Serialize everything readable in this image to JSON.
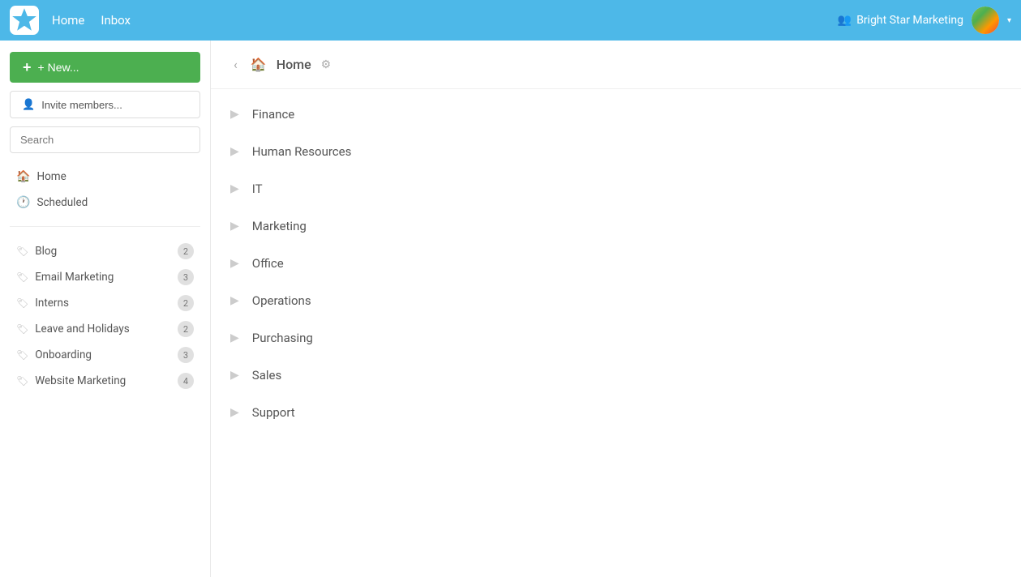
{
  "topnav": {
    "links": [
      {
        "label": "Home",
        "name": "home-nav-link"
      },
      {
        "label": "Inbox",
        "name": "inbox-nav-link"
      }
    ],
    "org_name": "Bright Star Marketing",
    "org_icon": "👥"
  },
  "sidebar": {
    "new_button_label": "+ New...",
    "invite_button_label": "Invite members...",
    "search_placeholder": "Search",
    "nav_items": [
      {
        "label": "Home",
        "icon": "🏠",
        "name": "sidebar-home"
      },
      {
        "label": "Scheduled",
        "icon": "🕐",
        "name": "sidebar-scheduled"
      }
    ],
    "tags": [
      {
        "label": "Blog",
        "badge": "2",
        "name": "tag-blog"
      },
      {
        "label": "Email Marketing",
        "badge": "3",
        "name": "tag-email-marketing"
      },
      {
        "label": "Interns",
        "badge": "2",
        "name": "tag-interns"
      },
      {
        "label": "Leave and Holidays",
        "badge": "2",
        "name": "tag-leave-holidays"
      },
      {
        "label": "Onboarding",
        "badge": "3",
        "name": "tag-onboarding"
      },
      {
        "label": "Website Marketing",
        "badge": "4",
        "name": "tag-website-marketing"
      }
    ]
  },
  "content": {
    "breadcrumb": "Home",
    "items": [
      {
        "label": "Finance",
        "name": "item-finance"
      },
      {
        "label": "Human Resources",
        "name": "item-hr"
      },
      {
        "label": "IT",
        "name": "item-it"
      },
      {
        "label": "Marketing",
        "name": "item-marketing"
      },
      {
        "label": "Office",
        "name": "item-office"
      },
      {
        "label": "Operations",
        "name": "item-operations"
      },
      {
        "label": "Purchasing",
        "name": "item-purchasing"
      },
      {
        "label": "Sales",
        "name": "item-sales"
      },
      {
        "label": "Support",
        "name": "item-support"
      }
    ]
  }
}
